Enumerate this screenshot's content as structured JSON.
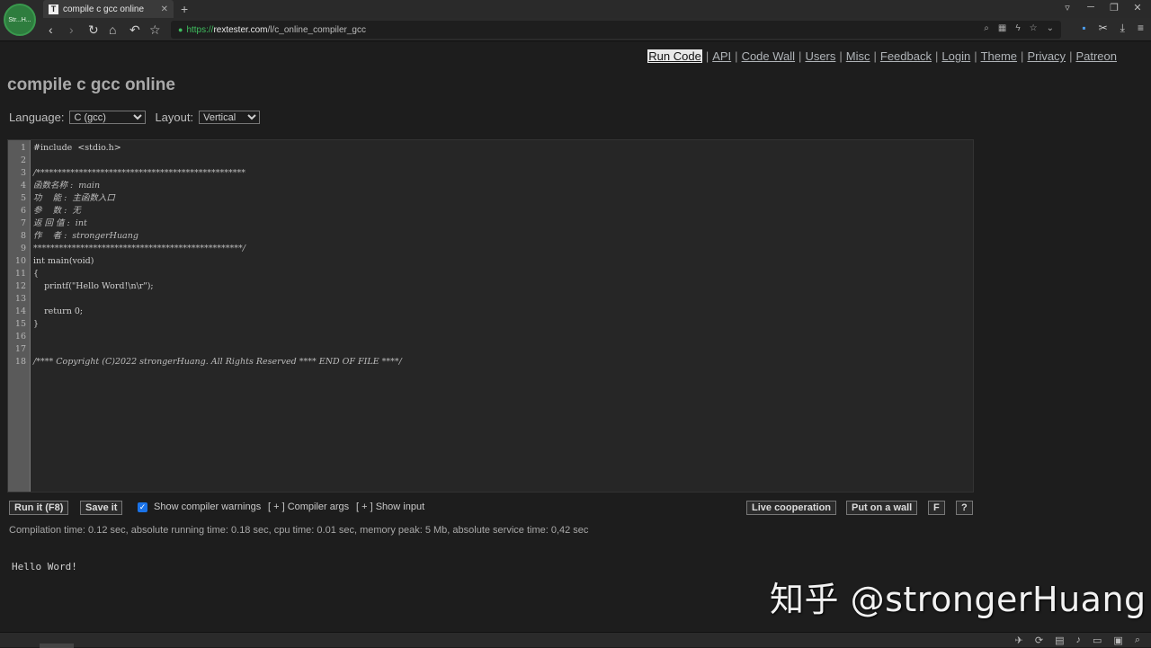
{
  "browser": {
    "tab_title": "compile c gcc online",
    "tab_favicon": "T",
    "avatar_text": "Str...H...",
    "url_scheme": "https://",
    "url_host": "rextester.com",
    "url_path": "/l/c_online_compiler_gcc",
    "nav_icons": [
      "back-icon",
      "forward-icon",
      "reload-icon",
      "home-icon",
      "undo-icon",
      "bookmark-star-icon"
    ],
    "window_controls": [
      "pin-icon",
      "minimize-icon",
      "restore-icon",
      "close-icon"
    ]
  },
  "nav": {
    "items": [
      "Run Code",
      "API",
      "Code Wall",
      "Users",
      "Misc",
      "Feedback",
      "Login",
      "Theme",
      "Privacy",
      "Patreon"
    ],
    "active": "Run Code"
  },
  "page_title": "compile c gcc online",
  "options": {
    "language_label": "Language:",
    "language_value": "C (gcc)",
    "layout_label": "Layout:",
    "layout_value": "Vertical"
  },
  "editor": {
    "lines": [
      "#include  <stdio.h>",
      "",
      "/*************************************************",
      "函数名称 :  main",
      "功    能 :  主函数入口",
      "参    数 :  无",
      "返 回 值 :  int",
      "作    者 :  strongerHuang",
      "*************************************************/",
      "int main(void)",
      "{",
      "    printf(\"Hello Word!\\n\\r\");",
      "",
      "    return 0;",
      "}",
      "",
      "",
      "/**** Copyright (C)2022 strongerHuang. All Rights Reserved **** END OF FILE ****/"
    ]
  },
  "toolbar": {
    "run_label": "Run it (F8)",
    "save_label": "Save it",
    "show_warnings_label": "Show compiler warnings",
    "compiler_args_label": "[ + ] Compiler args",
    "show_input_label": "[ + ] Show input",
    "live_coop_label": "Live cooperation",
    "wall_label": "Put on a wall",
    "f_label": "F",
    "help_label": "?"
  },
  "stats": "Compilation time: 0.12 sec, absolute running time: 0.18 sec, cpu time: 0.01 sec, memory peak: 5 Mb, absolute service time: 0,42 sec",
  "output": "Hello Word!",
  "watermark": "知乎 @strongerHuang"
}
